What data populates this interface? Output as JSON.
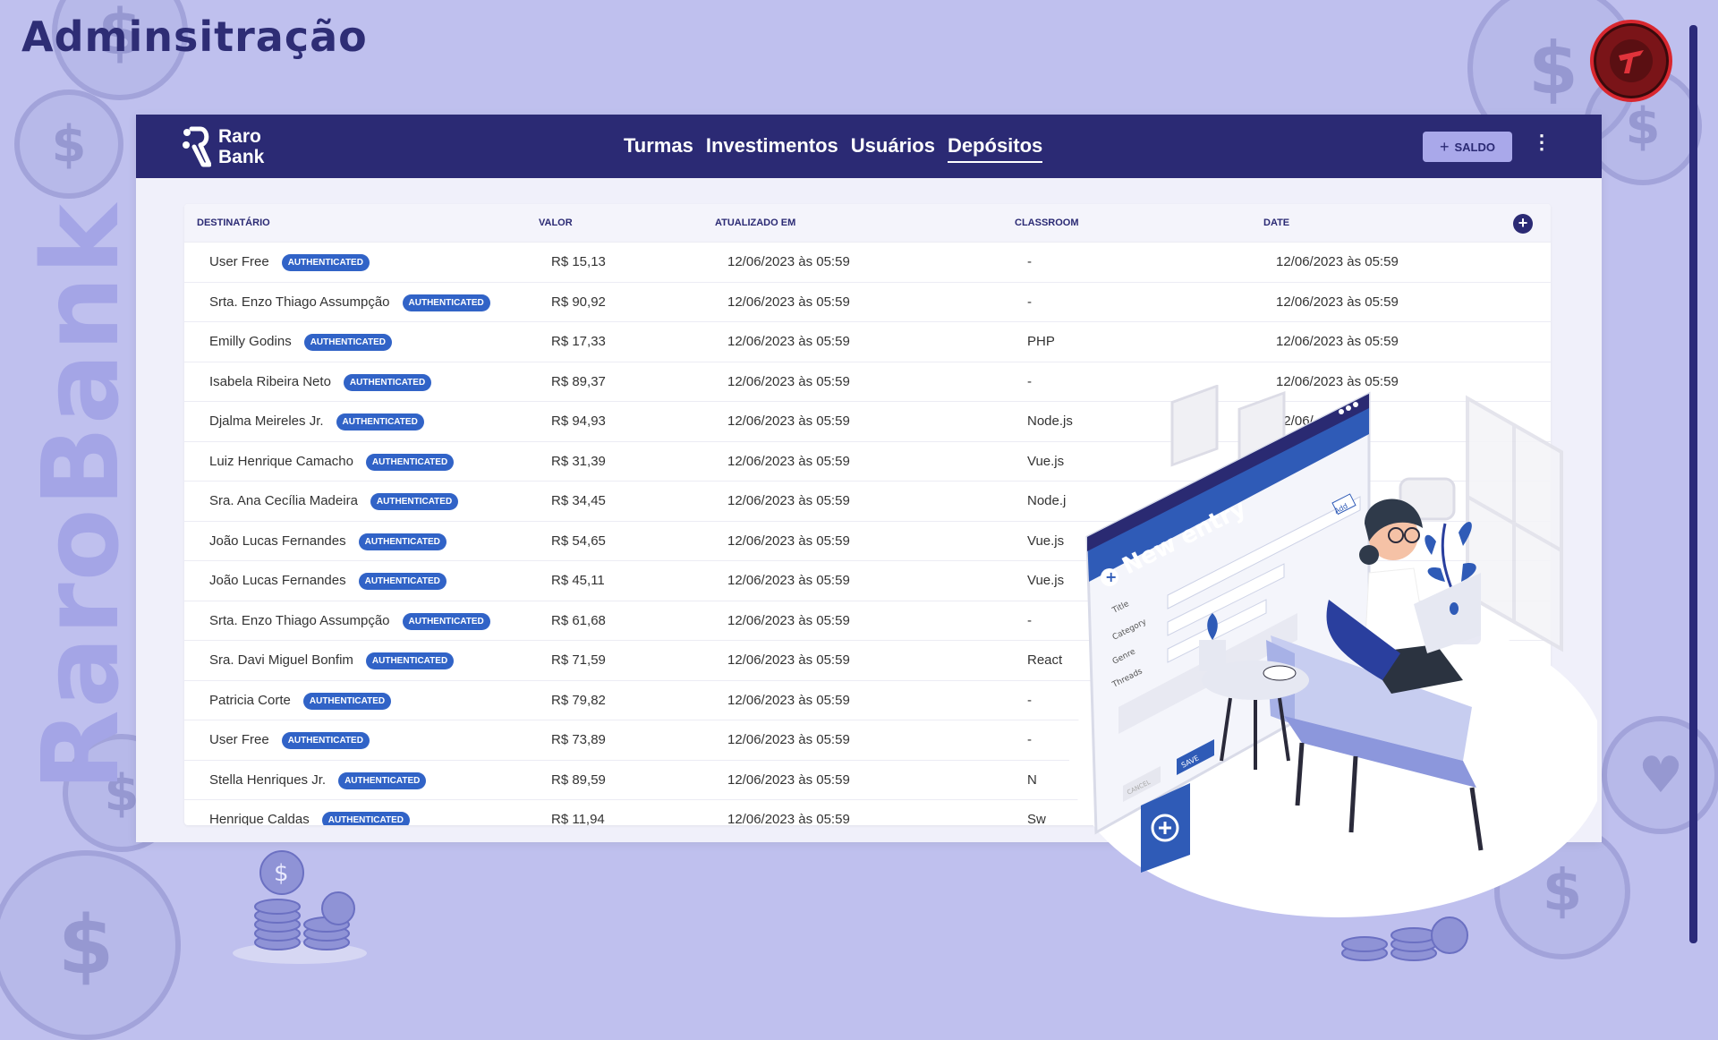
{
  "slide": {
    "title": "Adminsitração",
    "side_brand": "RaroBank"
  },
  "app": {
    "logo": {
      "line1": "Raro",
      "line2": "Bank"
    },
    "nav": [
      {
        "label": "Turmas",
        "active": false
      },
      {
        "label": "Investimentos",
        "active": false
      },
      {
        "label": "Usuários",
        "active": false
      },
      {
        "label": "Depósitos",
        "active": true
      }
    ],
    "saldo_button": "SALDO",
    "saldo_icon": "plus-icon",
    "menu_icon": "kebab-menu-icon"
  },
  "table": {
    "columns": [
      "DESTINATÁRIO",
      "VALOR",
      "ATUALIZADO EM",
      "CLASSROOM",
      "DATE"
    ],
    "badge_color": "#3163c7",
    "rows": [
      {
        "name": "User Free",
        "badge": "AUTHENTICATED",
        "valor": "R$ 15,13",
        "atualizado": "12/06/2023 às 05:59",
        "classroom": "-",
        "date": "12/06/2023 às 05:59"
      },
      {
        "name": "Srta. Enzo Thiago Assumpção",
        "badge": "AUTHENTICATED",
        "valor": "R$ 90,92",
        "atualizado": "12/06/2023 às 05:59",
        "classroom": "-",
        "date": "12/06/2023 às 05:59"
      },
      {
        "name": "Emilly Godins",
        "badge": "AUTHENTICATED",
        "valor": "R$ 17,33",
        "atualizado": "12/06/2023 às 05:59",
        "classroom": "PHP",
        "date": "12/06/2023 às 05:59"
      },
      {
        "name": "Isabela Ribeira Neto",
        "badge": "AUTHENTICATED",
        "valor": "R$ 89,37",
        "atualizado": "12/06/2023 às 05:59",
        "classroom": "-",
        "date": "12/06/2023 às 05:59"
      },
      {
        "name": "Djalma Meireles Jr.",
        "badge": "AUTHENTICATED",
        "valor": "R$ 94,93",
        "atualizado": "12/06/2023 às 05:59",
        "classroom": "Node.js",
        "date": "12/06/"
      },
      {
        "name": "Luiz Henrique Camacho",
        "badge": "AUTHENTICATED",
        "valor": "R$ 31,39",
        "atualizado": "12/06/2023 às 05:59",
        "classroom": "Vue.js",
        "date": ""
      },
      {
        "name": "Sra. Ana Cecília Madeira",
        "badge": "AUTHENTICATED",
        "valor": "R$ 34,45",
        "atualizado": "12/06/2023 às 05:59",
        "classroom": "Node.j",
        "date": ""
      },
      {
        "name": "João Lucas Fernandes",
        "badge": "AUTHENTICATED",
        "valor": "R$ 54,65",
        "atualizado": "12/06/2023 às 05:59",
        "classroom": "Vue.js",
        "date": ""
      },
      {
        "name": "João Lucas Fernandes",
        "badge": "AUTHENTICATED",
        "valor": "R$ 45,11",
        "atualizado": "12/06/2023 às 05:59",
        "classroom": "Vue.js",
        "date": ""
      },
      {
        "name": "Srta. Enzo Thiago Assumpção",
        "badge": "AUTHENTICATED",
        "valor": "R$ 61,68",
        "atualizado": "12/06/2023 às 05:59",
        "classroom": "-",
        "date": ""
      },
      {
        "name": "Sra. Davi Miguel Bonfim",
        "badge": "AUTHENTICATED",
        "valor": "R$ 71,59",
        "atualizado": "12/06/2023 às 05:59",
        "classroom": "React",
        "date": ""
      },
      {
        "name": "Patricia Corte",
        "badge": "AUTHENTICATED",
        "valor": "R$ 79,82",
        "atualizado": "12/06/2023 às 05:59",
        "classroom": "-",
        "date": ""
      },
      {
        "name": "User Free",
        "badge": "AUTHENTICATED",
        "valor": "R$ 73,89",
        "atualizado": "12/06/2023 às 05:59",
        "classroom": "-",
        "date": ""
      },
      {
        "name": "Stella Henriques Jr.",
        "badge": "AUTHENTICATED",
        "valor": "R$ 89,59",
        "atualizado": "12/06/2023 às 05:59",
        "classroom": "N",
        "date": ""
      },
      {
        "name": "Henrique Caldas",
        "badge": "AUTHENTICATED",
        "valor": "R$ 11,94",
        "atualizado": "12/06/2023 às 05:59",
        "classroom": "Sw",
        "date": ""
      }
    ]
  },
  "illustration": {
    "window_title": "New entry",
    "field_labels": [
      "Title",
      "Category",
      "Genre",
      "Threads"
    ],
    "add_label": "Add",
    "save_label": "SAVE",
    "cancel_label": "CANCEL"
  },
  "colors": {
    "primary": "#2b2a74",
    "background": "#bfc0ee",
    "accent": "#a9a8ea"
  }
}
